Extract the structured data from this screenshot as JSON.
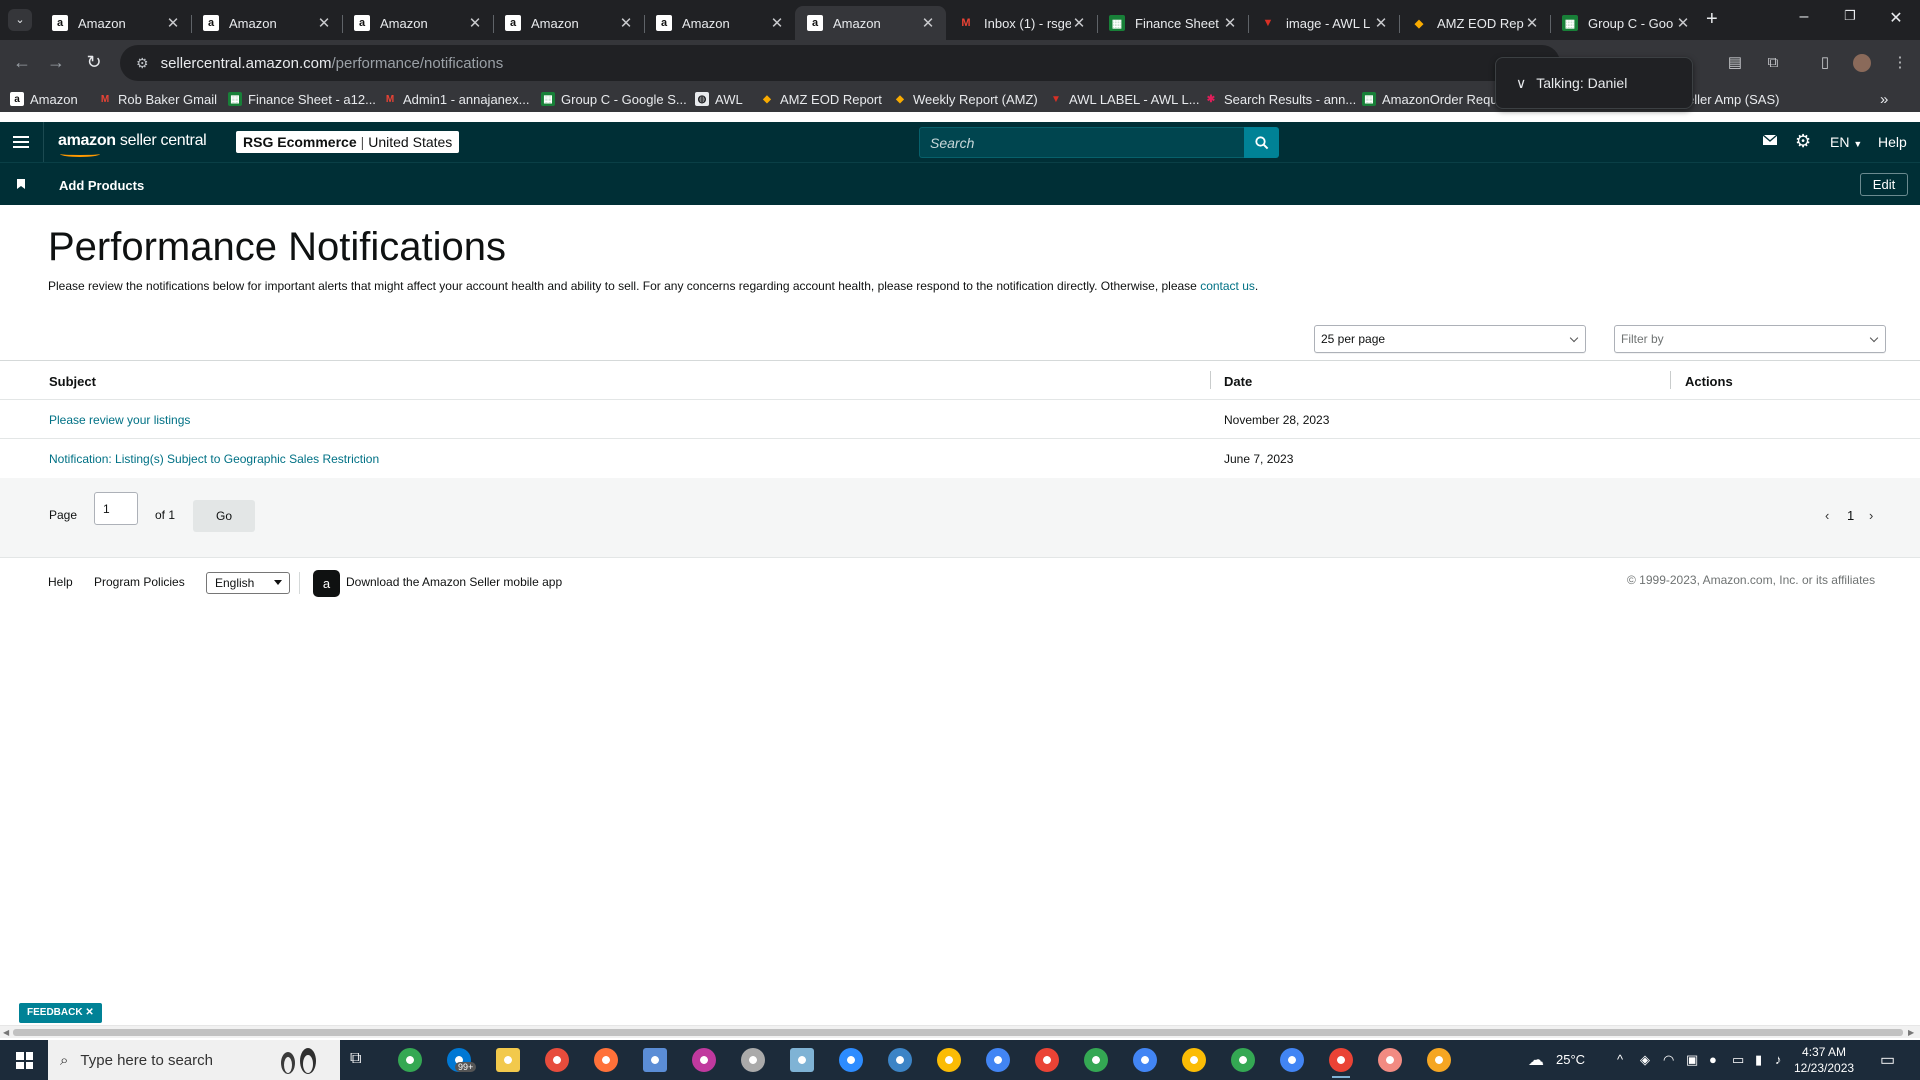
{
  "browser": {
    "tabs": [
      {
        "title": "Amazon",
        "icon": "amazon-icon",
        "active": false
      },
      {
        "title": "Amazon",
        "icon": "amazon-icon",
        "active": false
      },
      {
        "title": "Amazon",
        "icon": "amazon-icon",
        "active": false
      },
      {
        "title": "Amazon",
        "icon": "amazon-icon",
        "active": false
      },
      {
        "title": "Amazon",
        "icon": "amazon-icon",
        "active": false
      },
      {
        "title": "Amazon",
        "icon": "amazon-icon",
        "active": true
      },
      {
        "title": "Inbox (1) - rsge",
        "icon": "gmail-icon",
        "active": false
      },
      {
        "title": "Finance Sheet",
        "icon": "sheets-icon",
        "active": false
      },
      {
        "title": "image - AWL L",
        "icon": "awl-icon",
        "active": false
      },
      {
        "title": "AMZ EOD Rep",
        "icon": "report-icon",
        "active": false
      },
      {
        "title": "Group C - Goo",
        "icon": "sheets-icon",
        "active": false
      }
    ],
    "url_host": "sellercentral.amazon.com",
    "url_path": "/performance/notifications",
    "bookmarks": [
      {
        "label": "Amazon",
        "icon": "amazon-icon"
      },
      {
        "label": "Rob Baker Gmail",
        "icon": "gmail-icon"
      },
      {
        "label": "Finance Sheet - a12...",
        "icon": "sheets-icon"
      },
      {
        "label": "Admin1 - annajanex...",
        "icon": "gmail-icon"
      },
      {
        "label": "Group C - Google S...",
        "icon": "sheets-icon"
      },
      {
        "label": "AWL",
        "icon": "globe-icon"
      },
      {
        "label": "AMZ EOD Report",
        "icon": "report-icon"
      },
      {
        "label": "Weekly Report (AMZ)",
        "icon": "report-icon"
      },
      {
        "label": "AWL LABEL - AWL L...",
        "icon": "awl-icon"
      },
      {
        "label": "Search Results - ann...",
        "icon": "slack-icon"
      },
      {
        "label": "AmazonOrder Requ...",
        "icon": "sheets-icon"
      },
      {
        "label": "eller Amp (SAS)",
        "icon": ""
      }
    ],
    "talking_popup": "Talking: Daniel"
  },
  "header": {
    "logo_bold": "amazon",
    "logo_thin": " seller central",
    "account_name": "RSG Ecommerce",
    "account_region": "United States",
    "search_placeholder": "Search",
    "language": "EN",
    "help": "Help"
  },
  "nav": {
    "add_products": "Add Products",
    "edit": "Edit"
  },
  "main": {
    "title": "Performance Notifications",
    "intro": "Please review the notifications below for important alerts that might affect your account health and ability to sell. For any concerns regarding account health, please respond to the notification directly. Otherwise, please ",
    "intro_link": "contact us",
    "intro_end": ".",
    "per_page": "25 per page",
    "filter_placeholder": "Filter by",
    "columns": {
      "subject": "Subject",
      "date": "Date",
      "actions": "Actions"
    },
    "rows": [
      {
        "subject": "Please review your listings",
        "date": "November 28, 2023"
      },
      {
        "subject": "Notification: Listing(s) Subject to Geographic Sales Restriction",
        "date": "June 7, 2023"
      }
    ],
    "pager": {
      "label": "Page",
      "value": "1",
      "of": "of 1",
      "go": "Go",
      "current": "1"
    }
  },
  "footer": {
    "help": "Help",
    "policies": "Program Policies",
    "language": "English",
    "app_download": "Download the Amazon Seller mobile app",
    "copyright": "© 1999-2023, Amazon.com, Inc. or its affiliates"
  },
  "feedback": "FEEDBACK",
  "taskbar": {
    "search_placeholder": "Type here to search",
    "mail_badge": "99+",
    "weather": "25°C",
    "time": "4:37 AM",
    "date": "12/23/2023"
  },
  "colors": {
    "header_bg": "#002f36",
    "link": "#007185",
    "search_btn": "#008296",
    "chrome_dark": "#202124"
  }
}
